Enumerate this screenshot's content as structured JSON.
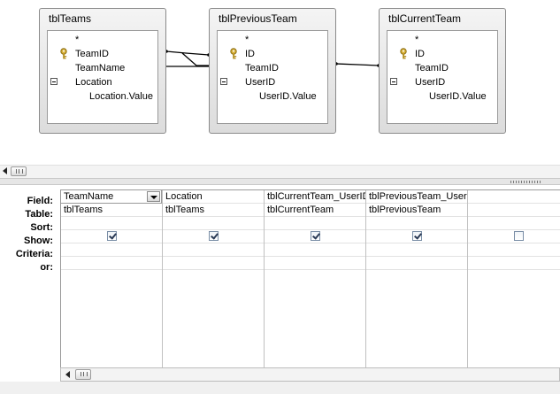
{
  "diagram": {
    "tables": [
      {
        "title": "tblTeams",
        "fields": [
          {
            "label": "*",
            "key": false,
            "expand": false,
            "indent": false
          },
          {
            "label": "TeamID",
            "key": true,
            "expand": false,
            "indent": false
          },
          {
            "label": "TeamName",
            "key": false,
            "expand": false,
            "indent": false
          },
          {
            "label": "Location",
            "key": false,
            "expand": true,
            "indent": false
          },
          {
            "label": "Location.Value",
            "key": false,
            "expand": false,
            "indent": true
          }
        ]
      },
      {
        "title": "tblPreviousTeam",
        "fields": [
          {
            "label": "*",
            "key": false,
            "expand": false,
            "indent": false
          },
          {
            "label": "ID",
            "key": true,
            "expand": false,
            "indent": false
          },
          {
            "label": "TeamID",
            "key": false,
            "expand": false,
            "indent": false
          },
          {
            "label": "UserID",
            "key": false,
            "expand": true,
            "indent": false
          },
          {
            "label": "UserID.Value",
            "key": false,
            "expand": false,
            "indent": true
          }
        ]
      },
      {
        "title": "tblCurrentTeam",
        "fields": [
          {
            "label": "*",
            "key": false,
            "expand": false,
            "indent": false
          },
          {
            "label": "ID",
            "key": true,
            "expand": false,
            "indent": false
          },
          {
            "label": "TeamID",
            "key": false,
            "expand": false,
            "indent": false
          },
          {
            "label": "UserID",
            "key": false,
            "expand": true,
            "indent": false
          },
          {
            "label": "UserID.Value",
            "key": false,
            "expand": false,
            "indent": true
          }
        ]
      }
    ]
  },
  "grid": {
    "row_labels": {
      "field": "Field:",
      "table": "Table:",
      "sort": "Sort:",
      "show": "Show:",
      "criteria": "Criteria:",
      "or": "or:"
    },
    "columns": [
      {
        "field": "TeamName",
        "table": "tblTeams",
        "show": true
      },
      {
        "field": "Location",
        "table": "tblTeams",
        "show": true
      },
      {
        "field": "tblCurrentTeam_UserID",
        "table": "tblCurrentTeam",
        "show": true
      },
      {
        "field": "tblPreviousTeam_UserID",
        "table": "tblPreviousTeam",
        "show": true
      },
      {
        "field": "",
        "table": "",
        "show": false
      }
    ]
  },
  "icons": {
    "key": "key-icon",
    "expand": "collapse-minus-icon",
    "dropdown": "dropdown-arrow-icon",
    "scroll_left": "scroll-left-arrow-icon",
    "checkbox": "checkbox-icon"
  }
}
